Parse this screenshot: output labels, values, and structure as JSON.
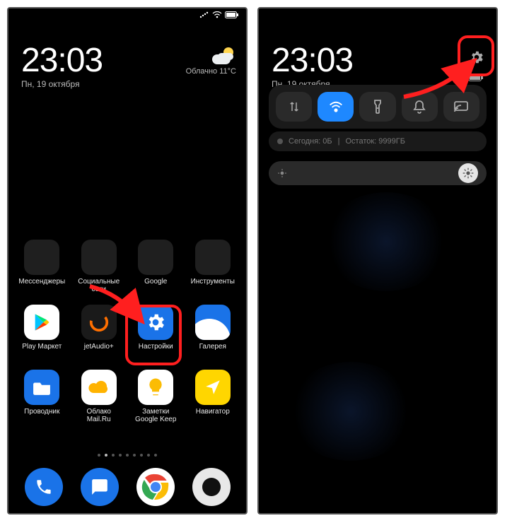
{
  "left": {
    "clock": "23:03",
    "date": "Пн, 19 октября",
    "weather": "Облачно  11°C",
    "apps_row1": [
      {
        "name": "messengers-folder",
        "label": "Мессенджеры"
      },
      {
        "name": "social-folder",
        "label": "Социальные\nсети"
      },
      {
        "name": "google-folder",
        "label": "Google"
      },
      {
        "name": "tools-folder",
        "label": "Инструменты"
      }
    ],
    "apps_row2": [
      {
        "name": "play-market",
        "label": "Play Маркет"
      },
      {
        "name": "jetaudio",
        "label": "jetAudio+"
      },
      {
        "name": "settings",
        "label": "Настройки"
      },
      {
        "name": "gallery",
        "label": "Галерея"
      }
    ],
    "apps_row3": [
      {
        "name": "file-explorer",
        "label": "Проводник"
      },
      {
        "name": "mailru-cloud",
        "label": "Облако\nMail.Ru"
      },
      {
        "name": "google-keep",
        "label": "Заметки\nGoogle Keep"
      },
      {
        "name": "navigator",
        "label": "Навигатор"
      }
    ],
    "dock": [
      {
        "name": "phone-app"
      },
      {
        "name": "messages-app"
      },
      {
        "name": "chrome-app"
      },
      {
        "name": "camera-app"
      }
    ]
  },
  "right": {
    "clock": "23:03",
    "date": "Пн, 19 октября",
    "usage_today": "Сегодня: 0Б",
    "usage_sep": "|",
    "usage_left": "Остаток: 9999ГБ",
    "tiles": [
      {
        "name": "mobile-data-tile",
        "on": false,
        "icon": "data"
      },
      {
        "name": "wifi-tile",
        "on": true,
        "icon": "wifi"
      },
      {
        "name": "flashlight-tile",
        "on": false,
        "icon": "flash"
      },
      {
        "name": "dnd-tile",
        "on": false,
        "icon": "bell"
      },
      {
        "name": "cast-tile",
        "on": false,
        "icon": "cast"
      }
    ]
  }
}
